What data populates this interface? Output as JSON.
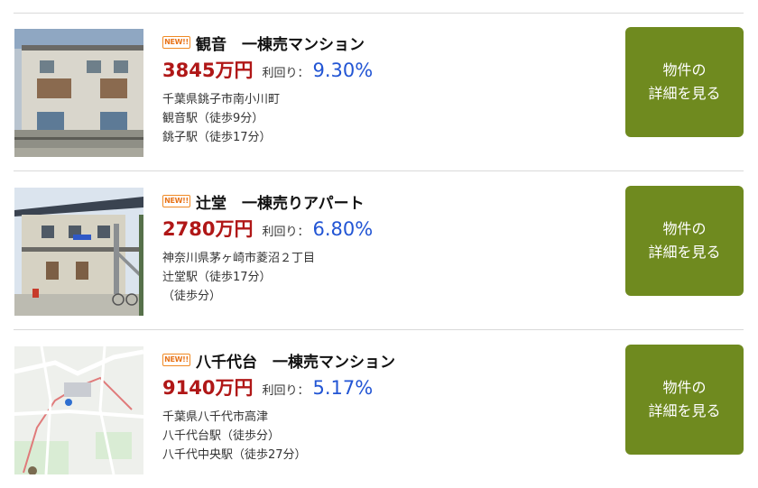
{
  "listings": [
    {
      "badge": "NEW!!",
      "title": "観音　一棟売マンション",
      "price": "3845万円",
      "yield_label": "利回り：",
      "yield": "9.30%",
      "address": "千葉県銚子市南小川町",
      "access1": "観音駅（徒歩9分）",
      "access2": "銚子駅（徒歩17分）",
      "button_line1": "物件の",
      "button_line2": "詳細を見る",
      "image_icon": "building-photo-icon"
    },
    {
      "badge": "NEW!!",
      "title": "辻堂　一棟売りアパート",
      "price": "2780万円",
      "yield_label": "利回り：",
      "yield": "6.80%",
      "address": "神奈川県茅ヶ崎市菱沼２丁目",
      "access1": "辻堂駅（徒歩17分）",
      "access2": "（徒歩分）",
      "button_line1": "物件の",
      "button_line2": "詳細を見る",
      "image_icon": "apartment-photo-icon"
    },
    {
      "badge": "NEW!!",
      "title": "八千代台　一棟売マンション",
      "price": "9140万円",
      "yield_label": "利回り：",
      "yield": "5.17%",
      "address": "千葉県八千代市高津",
      "access1": "八千代台駅（徒歩分）",
      "access2": "八千代中央駅（徒歩27分）",
      "button_line1": "物件の",
      "button_line2": "詳細を見る",
      "image_icon": "map-icon"
    }
  ],
  "colors": {
    "price": "#b01717",
    "yield": "#2255d4",
    "button": "#6f8a1f",
    "badge": "#f08a24"
  }
}
